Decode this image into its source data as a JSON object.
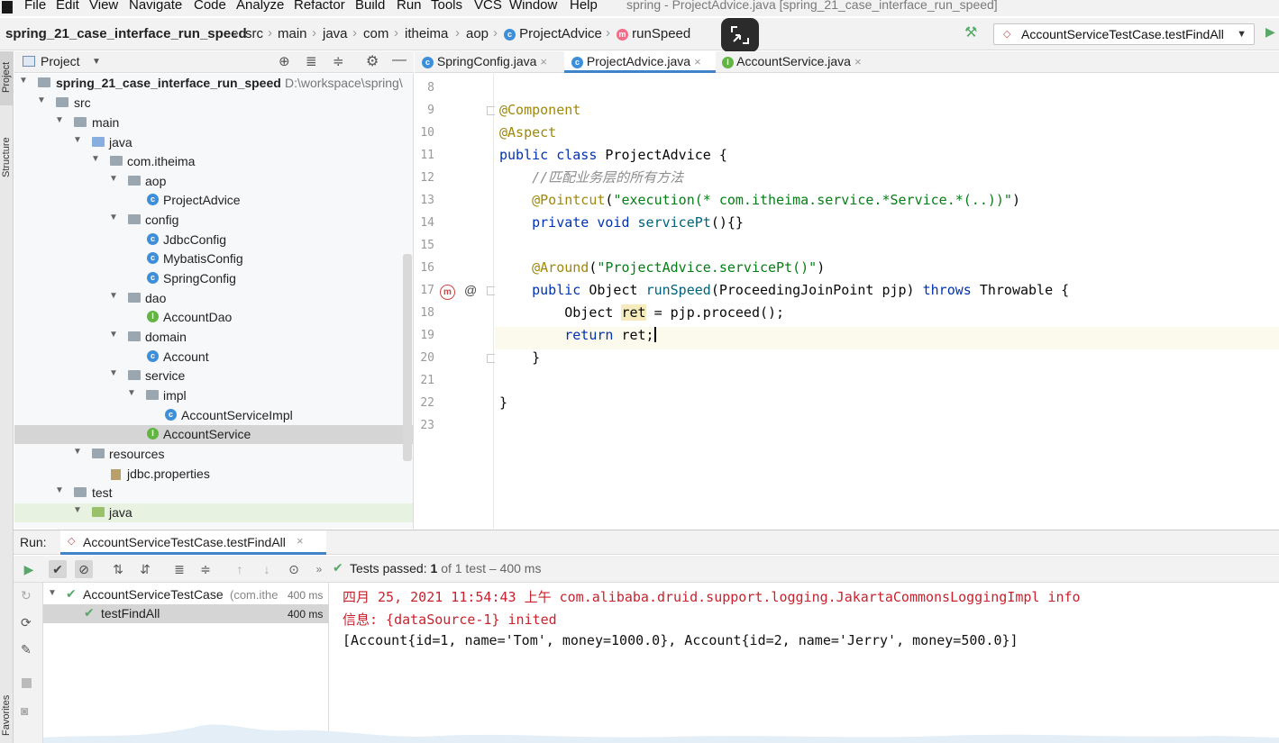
{
  "menu": {
    "items": [
      "File",
      "Edit",
      "View",
      "Navigate",
      "Code",
      "Analyze",
      "Refactor",
      "Build",
      "Run",
      "Tools",
      "VCS",
      "Window",
      "Help"
    ],
    "window_title": "spring - ProjectAdvice.java [spring_21_case_interface_run_speed]"
  },
  "breadcrumb": {
    "project": "spring_21_case_interface_run_speed",
    "parts": [
      "src",
      "main",
      "java",
      "com",
      "itheima",
      "aop"
    ],
    "class": "ProjectAdvice",
    "method": "runSpeed"
  },
  "run_config": {
    "label": "AccountServiceTestCase.testFindAll"
  },
  "left_strip": {
    "project": "Project",
    "structure": "Structure",
    "favorites": "Favorites"
  },
  "project_panel": {
    "title": "Project",
    "root_name": "spring_21_case_interface_run_speed",
    "root_path": "D:\\workspace\\spring\\",
    "tree": [
      {
        "label": "src"
      },
      {
        "label": "main"
      },
      {
        "label": "java"
      },
      {
        "label": "com.itheima"
      },
      {
        "label": "aop"
      },
      {
        "label": "ProjectAdvice"
      },
      {
        "label": "config"
      },
      {
        "label": "JdbcConfig"
      },
      {
        "label": "MybatisConfig"
      },
      {
        "label": "SpringConfig"
      },
      {
        "label": "dao"
      },
      {
        "label": "AccountDao"
      },
      {
        "label": "domain"
      },
      {
        "label": "Account"
      },
      {
        "label": "service"
      },
      {
        "label": "impl"
      },
      {
        "label": "AccountServiceImpl"
      },
      {
        "label": "AccountService"
      },
      {
        "label": "resources"
      },
      {
        "label": "jdbc.properties"
      },
      {
        "label": "test"
      },
      {
        "label": "java"
      }
    ]
  },
  "tabs": [
    {
      "label": "SpringConfig.java"
    },
    {
      "label": "ProjectAdvice.java"
    },
    {
      "label": "AccountService.java"
    }
  ],
  "editor": {
    "line_numbers": [
      "8",
      "9",
      "10",
      "11",
      "12",
      "13",
      "14",
      "15",
      "16",
      "17",
      "18",
      "19",
      "20",
      "21",
      "22",
      "23"
    ],
    "code": {
      "l9": "@Component",
      "l10": "@Aspect",
      "l11a": "public class ",
      "l11b": "ProjectAdvice {",
      "l12": "    //匹配业务层的所有方法",
      "l13a": "    @Pointcut",
      "l13b": "(",
      "l13c": "\"execution(* com.itheima.service.*Service.*(..))\"",
      "l13d": ")",
      "l14a": "    private void ",
      "l14b": "servicePt",
      "l14c": "(){}",
      "l16a": "    @Around",
      "l16b": "(",
      "l16c": "\"ProjectAdvice.servicePt()\"",
      "l16d": ")",
      "l17a": "    public ",
      "l17b": "Object ",
      "l17c": "runSpeed",
      "l17d": "(ProceedingJoinPoint pjp) ",
      "l17e": "throws ",
      "l17f": "Throwable {",
      "l18a": "        Object ",
      "l18b": "ret",
      "l18c": " = pjp.proceed();",
      "l19a": "        return ",
      "l19b": "ret;",
      "l20": "    }",
      "l22": "}"
    }
  },
  "run": {
    "label": "Run:",
    "config_tab": "AccountServiceTestCase.testFindAll",
    "status": "Tests passed:",
    "status_count": "1",
    "status_rest": "of 1 test – 400 ms",
    "tests": [
      {
        "name": "AccountServiceTestCase",
        "detail": "(com.ithe",
        "time": "400 ms"
      },
      {
        "name": "testFindAll",
        "time": "400 ms"
      }
    ],
    "console": [
      "四月 25, 2021 11:54:43 上午 com.alibaba.druid.support.logging.JakartaCommonsLoggingImpl info",
      "信息: {dataSource-1} inited",
      "[Account{id=1, name='Tom', money=1000.0}, Account{id=2, name='Jerry', money=500.0}]"
    ]
  },
  "colors": {
    "keyword": "#0033b3",
    "annotation": "#9e880d",
    "string": "#067d17",
    "console_red": "#c7222d",
    "accent": "#4083c9",
    "pass_green": "#59a869"
  }
}
